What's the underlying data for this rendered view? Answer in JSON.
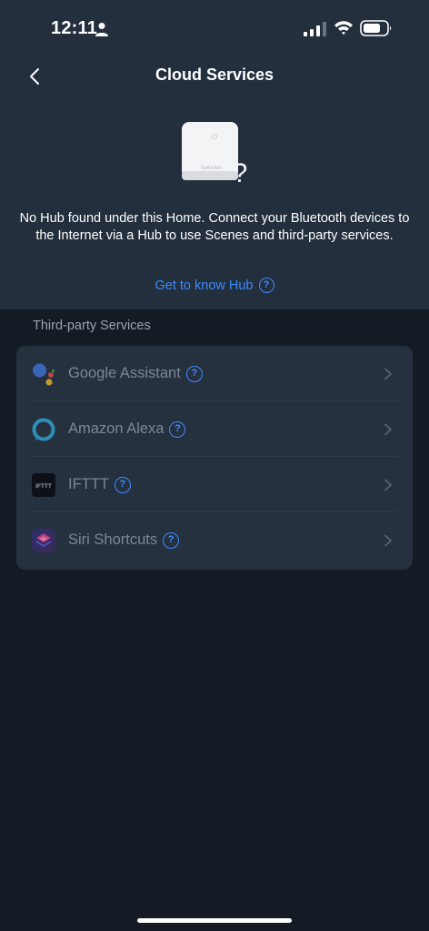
{
  "status_bar": {
    "time": "12:11"
  },
  "header": {
    "title": "Cloud Services"
  },
  "hub": {
    "device_label": "SwitchBot",
    "message": "No Hub found under this Home. Connect your Bluetooth devices to the Internet via a Hub to use Scenes and third-party services.",
    "link_label": "Get to know Hub"
  },
  "section": {
    "title": "Third-party Services"
  },
  "services": [
    {
      "label": "Google Assistant",
      "icon": "google-assistant-icon"
    },
    {
      "label": "Amazon Alexa",
      "icon": "alexa-icon"
    },
    {
      "label": "IFTTT",
      "icon": "ifttt-icon",
      "icon_text": "IFTTT"
    },
    {
      "label": "Siri Shortcuts",
      "icon": "siri-shortcuts-icon"
    }
  ],
  "colors": {
    "accent": "#3d8bfd",
    "background": "#141b25",
    "header_background": "#232f3d",
    "card_background": "#26313f",
    "muted_text": "#7c8794"
  }
}
